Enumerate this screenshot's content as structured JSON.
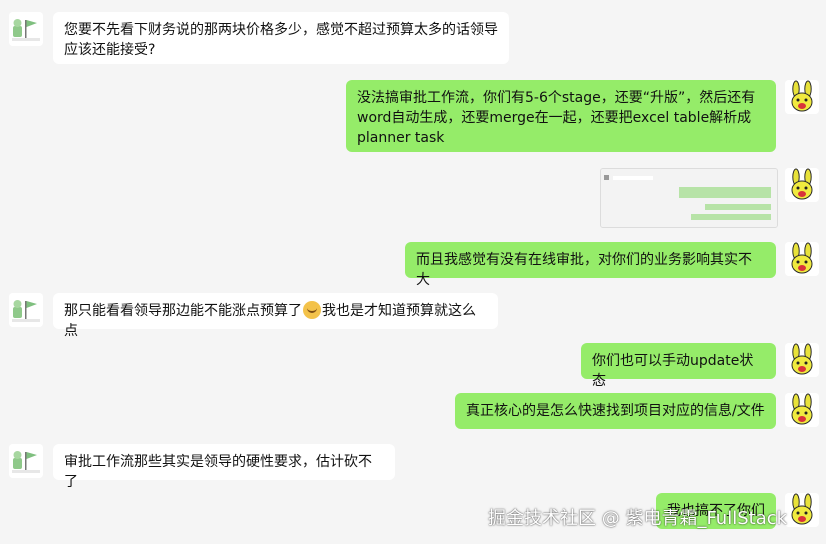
{
  "messages": [
    {
      "side": "left",
      "text_line1": "您要不先看下财务说的那两块价格多少，感觉不超过预算太多的话领导",
      "text_line2": "应该还能接受?"
    },
    {
      "side": "right",
      "text_line1": "没法搞审批工作流，你们有5-6个stage，还要“升版”，然后还有",
      "text_line2": "word自动生成，还要merge在一起，还要把excel table解析成",
      "text_line3": "planner task"
    },
    {
      "side": "right",
      "type": "image",
      "thumb_text": "chat screenshot"
    },
    {
      "side": "right",
      "text": "而且我感觉有没有在线审批，对你们的业务影响其实不大"
    },
    {
      "side": "left",
      "text_a": "那只能看看领导那边能不能涨点预算了",
      "text_b": "我也是才知道预算就这么点"
    },
    {
      "side": "right",
      "text": "你们也可以手动update状态"
    },
    {
      "side": "right",
      "text": "真正核心的是怎么快速找到项目对应的信息/文件"
    },
    {
      "side": "left",
      "text": "审批工作流那些其实是领导的硬性要求，估计砍不了"
    },
    {
      "side": "right",
      "text": "我也搞不了你们"
    }
  ],
  "watermark": "掘金技术社区 @ 紫电青霜_FullStack",
  "colors": {
    "background": "#f5f5f5",
    "left_bubble": "#ffffff",
    "right_bubble": "#95ec69"
  },
  "icons": {
    "left_avatar": "flag-avatar-icon",
    "right_avatar": "rabbit-avatar-icon",
    "emoji": "facepalm-emoji-icon"
  }
}
